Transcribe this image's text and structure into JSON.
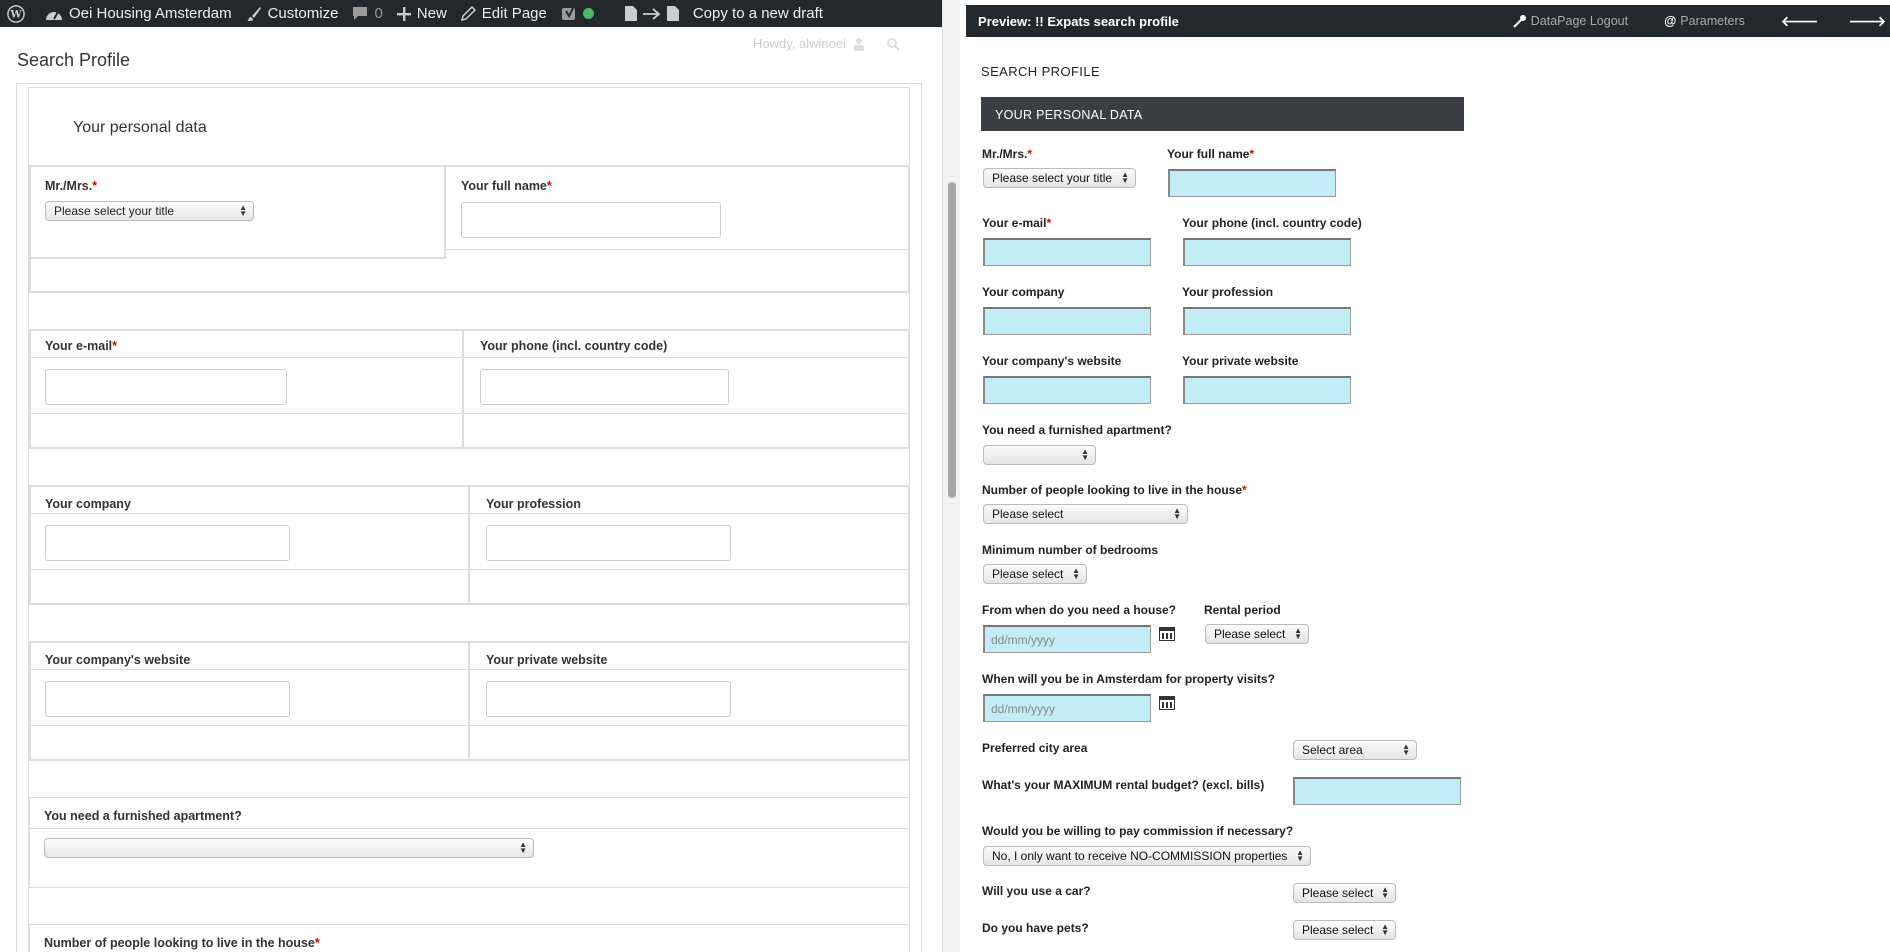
{
  "adminbar": {
    "site_name": "Oei Housing Amsterdam",
    "customize": "Customize",
    "comments_count": "0",
    "new": "New",
    "edit_page": "Edit Page",
    "copy_draft": "Copy to a new draft"
  },
  "left": {
    "howdy": "Howdy, alwinoei",
    "page_title": "Search Profile",
    "section_title": "Your personal data",
    "title_label": "Mr./Mrs.",
    "title_select": "Please select your title",
    "fullname_label": "Your full name",
    "email_label": "Your e-mail",
    "phone_label": "Your phone (incl. country code)",
    "company_label": "Your company",
    "profession_label": "Your profession",
    "company_website_label": "Your company's website",
    "private_website_label": "Your private website",
    "furnished_label": "You need a furnished apartment?",
    "people_label": "Number of people looking to live in the house",
    "required_mark": "*"
  },
  "preview": {
    "title": "Preview: !! Expats search profile",
    "logout": "DataPage Logout",
    "parameters": "Parameters",
    "heading": "SEARCH PROFILE",
    "band": "YOUR PERSONAL DATA",
    "title_label": "Mr./Mrs.",
    "title_select": "Please select your title",
    "fullname_label": "Your full name",
    "email_label": "Your e-mail",
    "phone_label": "Your phone (incl. country code)",
    "company_label": "Your company",
    "profession_label": "Your profession",
    "company_website_label": "Your company's website",
    "private_website_label": "Your private website",
    "furnished_label": "You need a furnished apartment?",
    "people_label": "Number of people looking to live in the house",
    "people_select": "Please select",
    "bedrooms_label": "Minimum number of bedrooms",
    "bedrooms_select": "Please select",
    "from_label": "From when do you need a house?",
    "date_placeholder": "dd/mm/yyyy",
    "rental_label": "Rental period",
    "rental_select": "Please select",
    "visits_label": "When will you be in Amsterdam for property visits?",
    "area_label": "Preferred city area",
    "area_select": "Select area",
    "budget_label": "What's your MAXIMUM rental budget? (excl. bills)",
    "commission_label": "Would you be willing to pay commission if necessary?",
    "commission_select": "No, I only want to receive NO-COMMISSION properties",
    "car_label": "Will you use a car?",
    "car_select": "Please select",
    "pets_label": "Do you have pets?",
    "pets_select": "Please select",
    "required_mark": "*"
  },
  "colors": {
    "adminbar": "#23282d",
    "input_fill": "#c2ecf6",
    "required": "#dd0000",
    "band": "#3a3e42"
  }
}
